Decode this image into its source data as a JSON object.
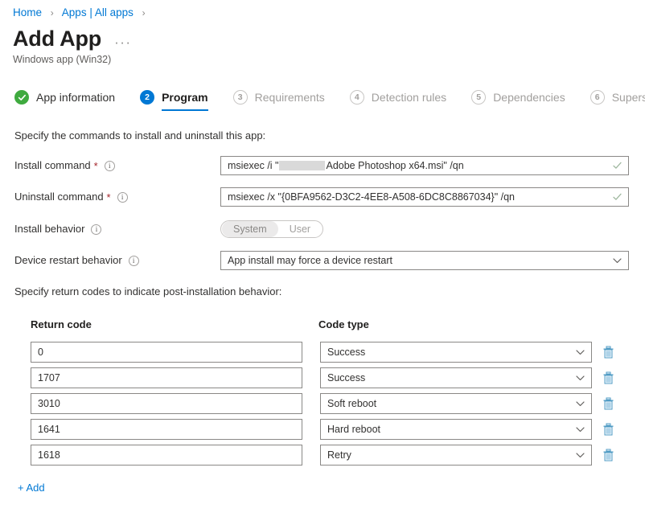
{
  "breadcrumb": {
    "items": [
      {
        "label": "Home"
      },
      {
        "label": "Apps | All apps"
      }
    ],
    "separator": "›"
  },
  "header": {
    "title": "Add App",
    "subtitle": "Windows app (Win32)",
    "more_label": "···"
  },
  "wizard": {
    "tabs": [
      {
        "number": "✓",
        "label": "App information",
        "state": "done"
      },
      {
        "number": "2",
        "label": "Program",
        "state": "active"
      },
      {
        "number": "3",
        "label": "Requirements",
        "state": "pending"
      },
      {
        "number": "4",
        "label": "Detection rules",
        "state": "pending"
      },
      {
        "number": "5",
        "label": "Dependencies",
        "state": "pending"
      },
      {
        "number": "6",
        "label": "Supersedence",
        "state": "pending"
      }
    ]
  },
  "program": {
    "intro_commands": "Specify the commands to install and uninstall this app:",
    "intro_return_codes": "Specify return codes to indicate post-installation behavior:",
    "install_command": {
      "label": "Install command",
      "required_mark": "*",
      "info": "i",
      "value_prefix": "msiexec /i \"",
      "value_suffix": " Adobe Photoshop x64.msi\" /qn",
      "redacted": true,
      "valid": true
    },
    "uninstall_command": {
      "label": "Uninstall command",
      "required_mark": "*",
      "info": "i",
      "value": "msiexec /x \"{0BFA9562-D3C2-4EE8-A508-6DC8C8867034}\" /qn",
      "valid": true
    },
    "install_behavior": {
      "label": "Install behavior",
      "info": "i",
      "options": [
        "System",
        "User"
      ],
      "selected": "System"
    },
    "device_restart_behavior": {
      "label": "Device restart behavior",
      "info": "i",
      "selected": "App install may force a device restart"
    }
  },
  "return_codes": {
    "columns": [
      "Return code",
      "Code type"
    ],
    "rows": [
      {
        "code": "0",
        "type": "Success"
      },
      {
        "code": "1707",
        "type": "Success"
      },
      {
        "code": "3010",
        "type": "Soft reboot"
      },
      {
        "code": "1641",
        "type": "Hard reboot"
      },
      {
        "code": "1618",
        "type": "Retry"
      }
    ],
    "delete_icon": "trash-icon",
    "add_label": "+ Add"
  },
  "colors": {
    "accent": "#0078d4",
    "success": "#3faa3f",
    "required": "#a4262c",
    "delete_icon": "#4f9bc4",
    "redaction": "#d9d9d9"
  }
}
